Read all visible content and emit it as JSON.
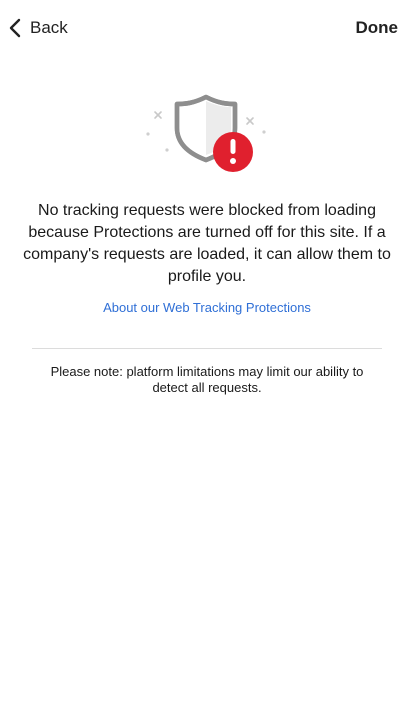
{
  "nav": {
    "back_label": "Back",
    "done_label": "Done"
  },
  "main": {
    "message": "No tracking requests were blocked from loading because Protections are turned off for this site. If a company's requests are loaded, it can allow them to profile you.",
    "link_label": "About our Web Tracking Protections",
    "note": "Please note: platform limitations may limit our ability to detect all requests."
  },
  "icons": {
    "back": "chevron-left-icon",
    "shield": "shield-icon",
    "alert": "alert-exclamation-icon"
  },
  "colors": {
    "link": "#2f6fd6",
    "alert": "#e0202e",
    "shield_outline": "#8e8e8e"
  }
}
